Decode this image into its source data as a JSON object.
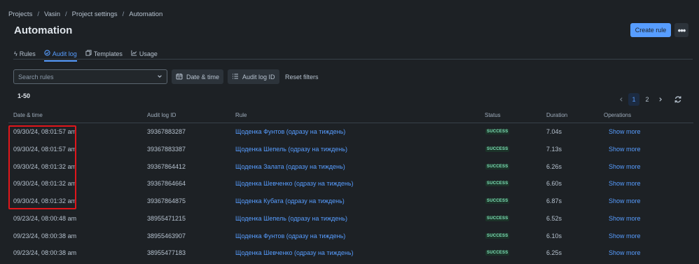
{
  "breadcrumb": [
    "Projects",
    "Vasin",
    "Project settings",
    "Automation"
  ],
  "breadcrumb_sep": "/",
  "page_title": "Automation",
  "header": {
    "create_rule_label": "Create rule",
    "more_icon": "more-horizontal-icon"
  },
  "tabs": [
    {
      "label": "Rules",
      "icon": "lightning-icon",
      "active": false
    },
    {
      "label": "Audit log",
      "icon": "check-circle-icon",
      "active": true
    },
    {
      "label": "Templates",
      "icon": "templates-icon",
      "active": false
    },
    {
      "label": "Usage",
      "icon": "chart-icon",
      "active": false
    }
  ],
  "filters": {
    "search_placeholder": "Search rules",
    "date_time_label": "Date & time",
    "audit_log_id_label": "Audit log ID",
    "reset_label": "Reset filters"
  },
  "range_label": "1-50",
  "pagination": {
    "pages": [
      "1",
      "2"
    ],
    "current": "1"
  },
  "table": {
    "columns": [
      "Date & time",
      "Audit log ID",
      "Rule",
      "Status",
      "Duration",
      "Operations"
    ],
    "rows": [
      {
        "date": "09/30/24, 08:01:57 am",
        "id": "39367883287",
        "rule": "Щоденка Фунтов (одразу на тиждень)",
        "status": "SUCCESS",
        "duration": "7.04s",
        "op": "Show more"
      },
      {
        "date": "09/30/24, 08:01:57 am",
        "id": "39367883387",
        "rule": "Щоденка Шепель (одразу на тиждень)",
        "status": "SUCCESS",
        "duration": "7.13s",
        "op": "Show more"
      },
      {
        "date": "09/30/24, 08:01:32 am",
        "id": "39367864412",
        "rule": "Щоденка Залата (одразу на тиждень)",
        "status": "SUCCESS",
        "duration": "6.26s",
        "op": "Show more"
      },
      {
        "date": "09/30/24, 08:01:32 am",
        "id": "39367864664",
        "rule": "Щоденка Шевченко (одразу на тиждень)",
        "status": "SUCCESS",
        "duration": "6.60s",
        "op": "Show more"
      },
      {
        "date": "09/30/24, 08:01:32 am",
        "id": "39367864875",
        "rule": "Щоденка Кубата (одразу на тиждень)",
        "status": "SUCCESS",
        "duration": "6.87s",
        "op": "Show more"
      },
      {
        "date": "09/23/24, 08:00:48 am",
        "id": "38955471215",
        "rule": "Щоденка Шепель (одразу на тиждень)",
        "status": "SUCCESS",
        "duration": "6.52s",
        "op": "Show more"
      },
      {
        "date": "09/23/24, 08:00:38 am",
        "id": "38955463907",
        "rule": "Щоденка Фунтов (одразу на тиждень)",
        "status": "SUCCESS",
        "duration": "6.10s",
        "op": "Show more"
      },
      {
        "date": "09/23/24, 08:00:38 am",
        "id": "38955477183",
        "rule": "Щоденка Шевченко (одразу на тиждень)",
        "status": "SUCCESS",
        "duration": "6.25s",
        "op": "Show more"
      }
    ]
  },
  "colors": {
    "accent": "#579dff",
    "background": "#1d2125",
    "success": "#7ee2b8",
    "highlight": "#e0161b"
  }
}
